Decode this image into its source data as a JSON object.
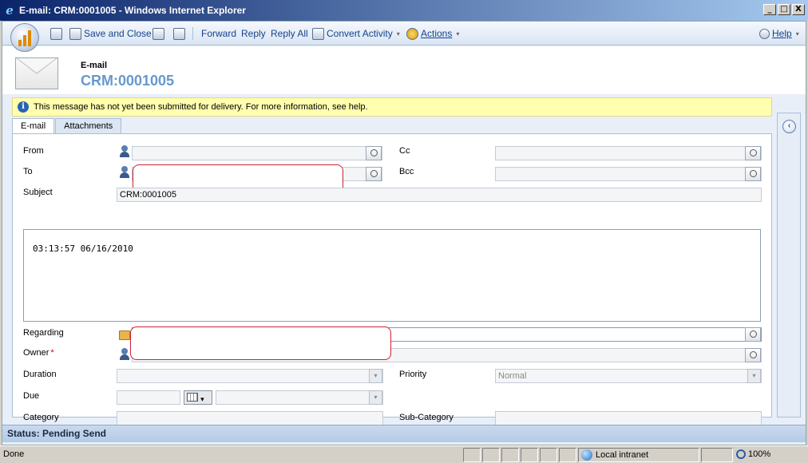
{
  "window": {
    "title": "E-mail: CRM:0001005 - Windows Internet Explorer",
    "min_glyph": "_",
    "max_glyph": "□",
    "close_glyph": "X"
  },
  "toolbar": {
    "save_close": "Save and Close",
    "forward": "Forward",
    "reply": "Reply",
    "reply_all": "Reply All",
    "convert_activity": "Convert Activity",
    "actions": "Actions",
    "help": "Help",
    "caret": "▾"
  },
  "header": {
    "type": "E-mail",
    "name": "CRM:0001005"
  },
  "info": {
    "message": "This message has not yet been submitted for delivery. For more information, see help."
  },
  "tabs": [
    "E-mail",
    "Attachments"
  ],
  "form": {
    "from_label": "From",
    "to_label": "To",
    "cc_label": "Cc",
    "bcc_label": "Bcc",
    "subject_label": "Subject",
    "subject_value": "CRM:0001005",
    "body_text": "03:13:57 06/16/2010",
    "regarding_label": "Regarding",
    "owner_label": "Owner",
    "required_marker": "*",
    "duration_label": "Duration",
    "priority_label": "Priority",
    "priority_value": "Normal",
    "due_label": "Due",
    "category_label": "Category",
    "subcategory_label": "Sub-Category",
    "dropdown_glyph": "▾"
  },
  "nav": {
    "collapse_glyph": "‹"
  },
  "status": {
    "text": "Status: Pending Send"
  },
  "browser_status": {
    "done": "Done",
    "zone": "Local intranet",
    "zoom": "100%"
  },
  "colors": {
    "accent": "#15428b",
    "title_accent": "#6699cc",
    "info_background": "#ffffae",
    "required": "#cc0000"
  }
}
